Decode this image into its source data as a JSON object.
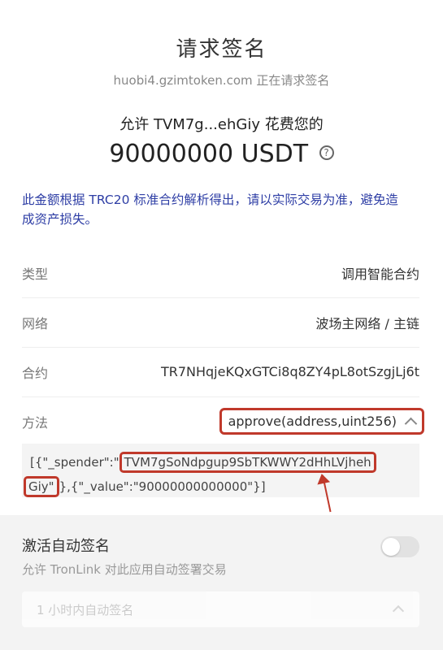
{
  "header": {
    "title": "请求签名",
    "origin": "huobi4.gzimtoken.com 正在请求签名",
    "allow_text": "允许 TVM7g...ehGiy 花费您的",
    "amount": "90000000 USDT",
    "help_glyph": "?"
  },
  "notice": "此金额根据 TRC20 标准合约解析得出，请以实际交易为准，避免造成资产损失。",
  "details": [
    {
      "label": "类型",
      "value": "调用智能合约"
    },
    {
      "label": "网络",
      "value": "波场主网络 / 主链"
    },
    {
      "label": "合约",
      "value": "TR7NHqjeKQxGTCi8q8ZY4pL8otSzgjLj6t"
    },
    {
      "label": "方法",
      "value": "approve(address,uint256)"
    }
  ],
  "params": {
    "prefix": "[{\"_spender\":\"",
    "spender_part1": "TVM7gSoNdpgup9SbTKWWY2dHhLVjheh",
    "spender_part2": "Giy\"",
    "suffix": "},{\"_value\":\"90000000000000\"}]"
  },
  "auto_sign": {
    "title": "激活自动签名",
    "subtitle": "允许 TronLink 对此应用自动签署交易",
    "duration": "1 小时内自动签名",
    "enabled": false
  },
  "colors": {
    "highlight": "#c0392b",
    "notice": "#2e3ea5"
  }
}
